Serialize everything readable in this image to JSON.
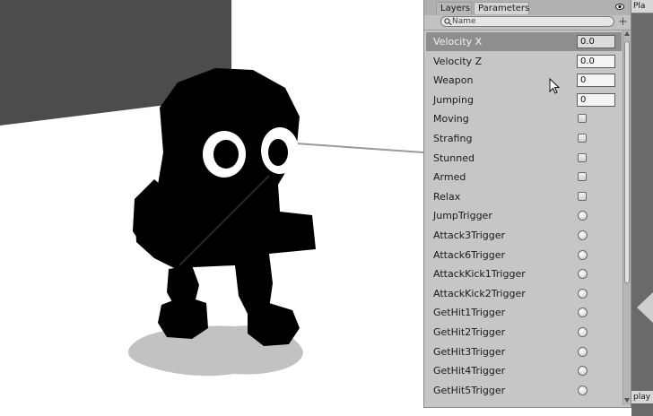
{
  "panel": {
    "tabs": [
      {
        "label": "Layers",
        "active": false
      },
      {
        "label": "Parameters",
        "active": true
      }
    ],
    "search": {
      "placeholder": "Name"
    },
    "add_label": "+",
    "parameters": [
      {
        "name": "Velocity X",
        "kind": "float",
        "value": "0.0",
        "selected": true
      },
      {
        "name": "Velocity Z",
        "kind": "float",
        "value": "0.0",
        "selected": false
      },
      {
        "name": "Weapon",
        "kind": "int",
        "value": "0",
        "selected": false
      },
      {
        "name": "Jumping",
        "kind": "int",
        "value": "0",
        "selected": false
      },
      {
        "name": "Moving",
        "kind": "bool",
        "selected": false
      },
      {
        "name": "Strafing",
        "kind": "bool",
        "selected": false
      },
      {
        "name": "Stunned",
        "kind": "bool",
        "selected": false
      },
      {
        "name": "Armed",
        "kind": "bool",
        "selected": false
      },
      {
        "name": "Relax",
        "kind": "bool",
        "selected": false
      },
      {
        "name": "JumpTrigger",
        "kind": "trigger",
        "selected": false
      },
      {
        "name": "Attack3Trigger",
        "kind": "trigger",
        "selected": false
      },
      {
        "name": "Attack6Trigger",
        "kind": "trigger",
        "selected": false
      },
      {
        "name": "AttackKick1Trigger",
        "kind": "trigger",
        "selected": false
      },
      {
        "name": "AttackKick2Trigger",
        "kind": "trigger",
        "selected": false
      },
      {
        "name": "GetHit1Trigger",
        "kind": "trigger",
        "selected": false
      },
      {
        "name": "GetHit2Trigger",
        "kind": "trigger",
        "selected": false
      },
      {
        "name": "GetHit3Trigger",
        "kind": "trigger",
        "selected": false
      },
      {
        "name": "GetHit4Trigger",
        "kind": "trigger",
        "selected": false
      },
      {
        "name": "GetHit5Trigger",
        "kind": "trigger",
        "selected": false
      }
    ]
  },
  "right_strip": {
    "top_label": "Pla",
    "bottom_label": "play"
  },
  "icons": {
    "visibility": "eye-icon",
    "search": "search-icon",
    "cursor": "cursor-icon"
  },
  "colors": {
    "panel_bg": "#c6c6c6",
    "selected_row": "#8e8e8e",
    "character": "#000000",
    "scene_wall": "#4d4d4d",
    "shadow": "#c3c3c3"
  }
}
